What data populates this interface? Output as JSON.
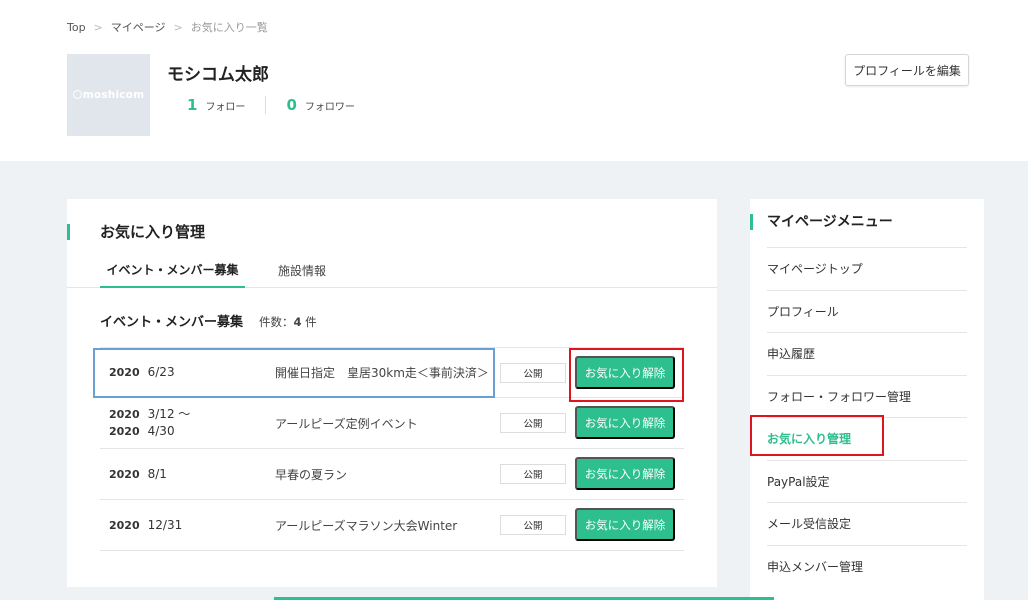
{
  "breadcrumb": {
    "items": [
      "Top",
      "マイページ"
    ],
    "current": "お気に入り一覧",
    "separator": ">"
  },
  "profile": {
    "avatar_logo": "moshicom",
    "name": "モシコム太郎",
    "follow_count": "1",
    "follow_label": "フォロー",
    "follower_count": "0",
    "follower_label": "フォロワー",
    "edit_button": "プロフィールを編集"
  },
  "favorites": {
    "title": "お気に入り管理",
    "tabs": [
      {
        "label": "イベント・メンバー募集",
        "active": true
      },
      {
        "label": "施設情報",
        "active": false
      }
    ],
    "list_heading": "イベント・メンバー募集",
    "count_prefix": "件数：",
    "count": "4",
    "count_suffix": " 件",
    "rows": [
      {
        "year1": "2020",
        "date1": "6/23",
        "year2": "",
        "date2": "",
        "title": "開催日指定　皇居30km走＜事前決済＞",
        "status": "公開",
        "action": "お気に入り解除"
      },
      {
        "year1": "2020",
        "date1": "3/12 ～",
        "year2": "2020",
        "date2": "4/30",
        "title": "アールピーズ定例イベント",
        "status": "公開",
        "action": "お気に入り解除"
      },
      {
        "year1": "2020",
        "date1": "8/1",
        "year2": "",
        "date2": "",
        "title": "早春の夏ラン",
        "status": "公開",
        "action": "お気に入り解除"
      },
      {
        "year1": "2020",
        "date1": "12/31",
        "year2": "",
        "date2": "",
        "title": "アールピーズマラソン大会Winter",
        "status": "公開",
        "action": "お気に入り解除"
      }
    ]
  },
  "sidebar": {
    "title": "マイページメニュー",
    "items": [
      {
        "label": "マイページトップ",
        "active": false
      },
      {
        "label": "プロフィール",
        "active": false
      },
      {
        "label": "申込履歴",
        "active": false
      },
      {
        "label": "フォロー・フォロワー管理",
        "active": false
      },
      {
        "label": "お気に入り管理",
        "active": true
      },
      {
        "label": "PayPal設定",
        "active": false
      },
      {
        "label": "メール受信設定",
        "active": false
      },
      {
        "label": "申込メンバー管理",
        "active": false
      }
    ]
  },
  "colors": {
    "accent": "#2ebf8e",
    "page_bg": "#eef2f5",
    "highlight_red": "#e0141e",
    "highlight_blue": "#6a9fd4"
  }
}
